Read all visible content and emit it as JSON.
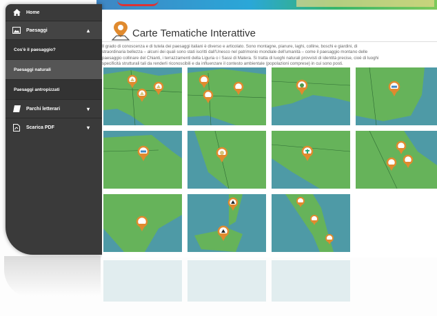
{
  "sidebar": {
    "items": [
      {
        "label": "Home",
        "icon": "home-icon"
      },
      {
        "label": "Paesaggi",
        "icon": "image-icon"
      },
      {
        "label": "Cos'è il paesaggio?"
      },
      {
        "label": "Paesaggi naturali"
      },
      {
        "label": "Paesaggi antropizzati"
      },
      {
        "label": "Parchi letterari",
        "icon": "book-icon"
      },
      {
        "label": "Scarica PDF",
        "icon": "pdf-icon"
      }
    ]
  },
  "header": {
    "title": "Carte Tematiche Interattive"
  },
  "description": {
    "line1": "Il grado di conoscenza e di tutela dei paesaggi italiani è diverso e articolato. Sono montagne, pianure, laghi, colline, boschi e giardini, di",
    "line2": "straordinaria bellezza – alcuni dei quali sono stati iscritti dall'Unesco nel patrimonio mondiale dell'umanità – come il paesaggio montano delle",
    "line3": "paesaggio collinare del Chianti, i terrazzamenti della Liguria o i Sassi di Matera. Si tratta di luoghi naturali provvisti di identità precise, cioè di luoghi",
    "line4": "specificità strutturali tali da renderli riconoscibili e da influenzare il contesto ambientale (popolazioni comprese) in cui sono posti."
  },
  "colors": {
    "sidebar": "#3a3a3a",
    "sea": "#4e9aa6",
    "land": "#66b35a",
    "pin": "#e08a2e"
  }
}
